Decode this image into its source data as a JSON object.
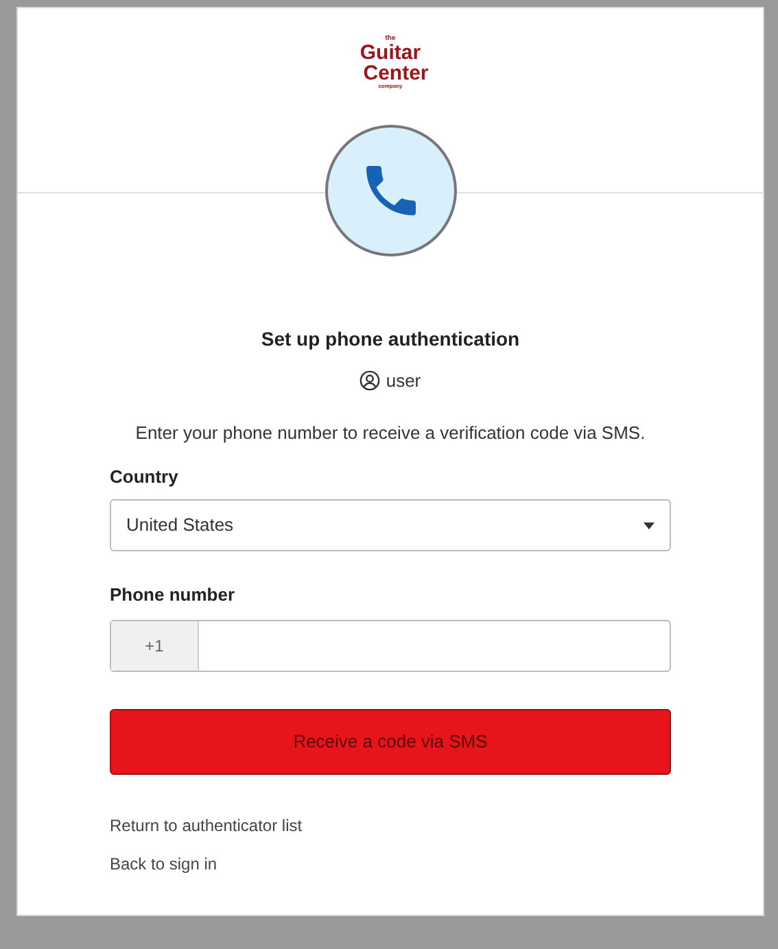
{
  "logo": {
    "line_1": "the",
    "line_2": "Guitar",
    "line_3": "Center",
    "line_4": "company"
  },
  "title": "Set up phone authentication",
  "user": "user",
  "instructions": "Enter your phone number to receive a verification code via SMS.",
  "country": {
    "label": "Country",
    "value": "United States"
  },
  "phone": {
    "label": "Phone number",
    "prefix": "+1"
  },
  "submit_button": "Receive a code via SMS",
  "links": [
    "Return to authenticator list",
    "Back to sign in"
  ]
}
